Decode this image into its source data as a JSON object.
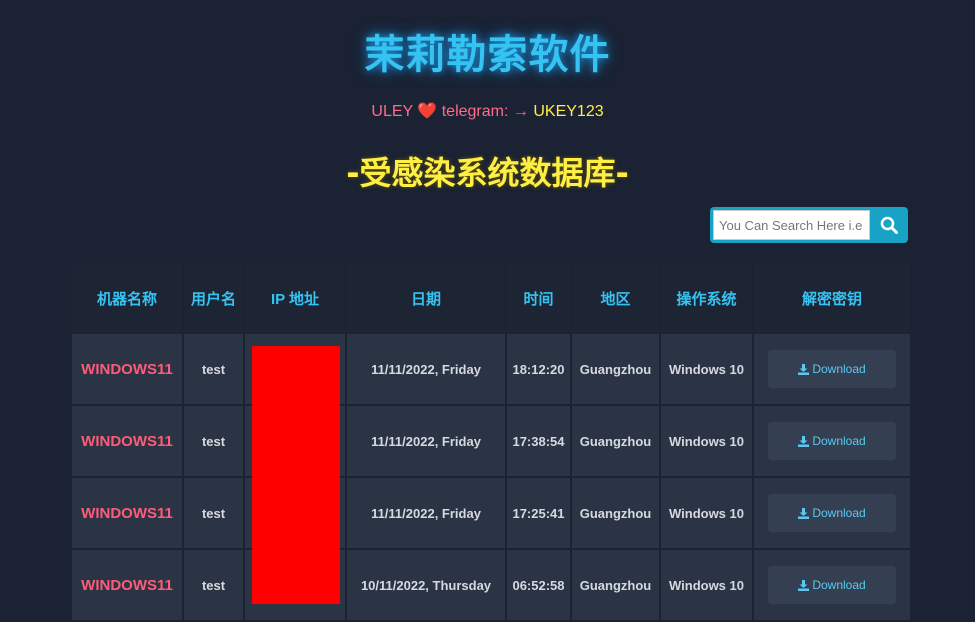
{
  "header": {
    "title": "茉莉勒索软件",
    "contact_prefix": "ULEY",
    "contact_heart": "❤️",
    "contact_label": "telegram:",
    "contact_arrow": "→",
    "contact_handle": "UKEY123",
    "section_heading": "-受感染系统数据库-"
  },
  "search": {
    "placeholder": "You Can Search Here i.e",
    "icon": "search-icon"
  },
  "colors": {
    "title": "#35c3f2",
    "heading": "#ffee44",
    "machine_name": "#ff5b7a",
    "redaction": "#ff0000",
    "background": "#1a2233"
  },
  "table": {
    "columns": [
      "机器名称",
      "用户名",
      "IP 地址",
      "日期",
      "时间",
      "地区",
      "操作系统",
      "解密密钥"
    ],
    "rows": [
      {
        "machine": "WINDOWS11",
        "user": "test",
        "date": "11/11/2022, Friday",
        "time": "18:12:20",
        "region": "Guangzhou",
        "os": "Windows 10",
        "action": "Download"
      },
      {
        "machine": "WINDOWS11",
        "user": "test",
        "date": "11/11/2022, Friday",
        "time": "17:38:54",
        "region": "Guangzhou",
        "os": "Windows 10",
        "action": "Download"
      },
      {
        "machine": "WINDOWS11",
        "user": "test",
        "date": "11/11/2022, Friday",
        "time": "17:25:41",
        "region": "Guangzhou",
        "os": "Windows 10",
        "action": "Download"
      },
      {
        "machine": "WINDOWS11",
        "user": "test",
        "date": "10/11/2022, Thursday",
        "time": "06:52:58",
        "region": "Guangzhou",
        "os": "Windows 10",
        "action": "Download"
      }
    ]
  }
}
